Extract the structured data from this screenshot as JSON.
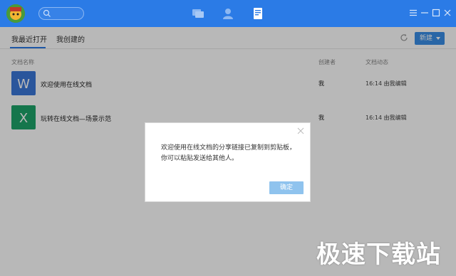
{
  "header": {
    "icons": [
      "avatar",
      "search-icon",
      "chat-icon",
      "contacts-icon",
      "documents-icon",
      "menu-icon",
      "minimize-icon",
      "maximize-icon",
      "close-icon"
    ]
  },
  "tabs": [
    {
      "label": "我最近打开",
      "active": true
    },
    {
      "label": "我创建的",
      "active": false
    }
  ],
  "toolbar": {
    "new_label": "新建"
  },
  "table": {
    "columns": [
      "文档名称",
      "创建者",
      "文档动态"
    ],
    "rows": [
      {
        "icon": "word-doc-icon",
        "icon_letter": "W",
        "icon_color": "#3b78d8",
        "title": "欢迎使用在线文档",
        "creator": "我",
        "activity": "16:14 由我编辑"
      },
      {
        "icon": "excel-doc-icon",
        "icon_letter": "X",
        "icon_color": "#1ea46a",
        "title": "玩转在线文档—场景示范",
        "creator": "我",
        "activity": "16:14 由我编辑"
      }
    ]
  },
  "dialog": {
    "message": "欢迎使用在线文档的分享链接已复制到剪贴板，你可以粘贴发送给其他人。",
    "ok_label": "确定"
  },
  "watermark": "极速下载站",
  "colors": {
    "accent": "#2b7be6",
    "button": "#3a8ee6",
    "ok_button": "#8fc3ee"
  }
}
